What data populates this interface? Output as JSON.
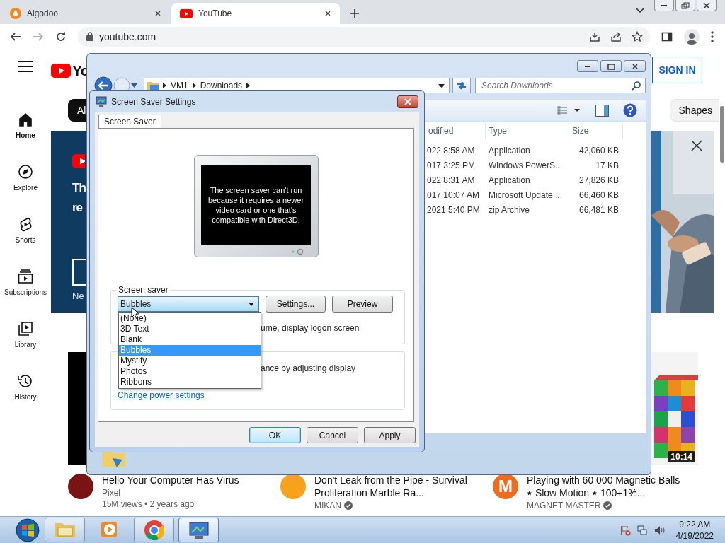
{
  "browser": {
    "tabs": [
      {
        "title": "Algodoo",
        "selected": false
      },
      {
        "title": "YouTube",
        "selected": true
      }
    ],
    "url": "youtube.com"
  },
  "youtube": {
    "logo_text": "Yo",
    "sign_in": "SIGN IN",
    "sidebar": [
      {
        "kind": "home",
        "label": "Home",
        "selected": true
      },
      {
        "kind": "explore",
        "label": "Explore",
        "selected": false
      },
      {
        "kind": "shorts",
        "label": "Shorts",
        "selected": false
      },
      {
        "kind": "subscriptions",
        "label": "Subscriptions",
        "selected": false
      },
      {
        "kind": "library",
        "label": "Library",
        "selected": false
      },
      {
        "kind": "history",
        "label": "History",
        "selected": false
      }
    ],
    "chips": [
      {
        "label": "Al",
        "selected": true
      },
      {
        "label": "Shapes",
        "selected": false
      }
    ],
    "banner": {
      "lines": [
        "Th",
        "re"
      ],
      "button_label": "Ne"
    },
    "videos": [
      {
        "title": "Hello Your Computer Has Virus",
        "channel": "Pixel",
        "verified": false,
        "meta": "15M views • 2 years ago",
        "color": "#7a1414"
      },
      {
        "title": "Don't Leak from the Pipe - Survival Proliferation Marble Ra...",
        "channel": "MIKAN",
        "verified": true,
        "color": "#f7a21b"
      },
      {
        "title": "Playing with 60 000 Magnetic Balls ⭑ Slow Motion ⭑ 100+1%...",
        "channel": "MAGNET MASTER",
        "verified": true,
        "color": "#f26b1d",
        "avatar_letter": "M",
        "duration": "10:14"
      }
    ]
  },
  "explorer": {
    "path": [
      "VM1",
      "Downloads"
    ],
    "search_placeholder": "Search Downloads",
    "columns": [
      "odified",
      "Type",
      "Size"
    ],
    "rows": [
      {
        "cells": [
          "022 8:58 AM",
          "Application",
          "42,060 KB"
        ]
      },
      {
        "cells": [
          "017 3:25 PM",
          "Windows PowerS...",
          "17 KB"
        ]
      },
      {
        "cells": [
          "022 8:31 AM",
          "Application",
          "27,826 KB"
        ]
      },
      {
        "cells": [
          "017 10:07 AM",
          "Microsoft Update ...",
          "66,460 KB"
        ]
      },
      {
        "cells": [
          "2021 5:40 PM",
          "zip Archive",
          "66,481 KB"
        ]
      }
    ]
  },
  "dialog": {
    "title": "Screen Saver Settings",
    "tabs": [
      {
        "label": "Screen Saver",
        "selected": true
      }
    ],
    "preview_message": "The screen saver can't run because it requires a newer video card or one that's compatible with Direct3D.",
    "group_label": "Screen saver",
    "dropdown": {
      "value": "Bubbles",
      "expanded": true,
      "options": [
        {
          "label": "(None)",
          "selected": false
        },
        {
          "label": "3D Text",
          "selected": false
        },
        {
          "label": "Blank",
          "selected": false
        },
        {
          "label": "Bubbles",
          "selected": true
        },
        {
          "label": "Mystify",
          "selected": false
        },
        {
          "label": "Photos",
          "selected": false
        },
        {
          "label": "Ribbons",
          "selected": false
        }
      ]
    },
    "group_buttons": [
      "Settings...",
      "Preview"
    ],
    "logon_text": "ume, display logon screen",
    "power_text": "ance by adjusting display",
    "power_link": "Change power settings",
    "buttons": [
      {
        "label": "OK",
        "default": true
      },
      {
        "label": "Cancel",
        "default": false
      },
      {
        "label": "Apply",
        "default": false
      }
    ]
  },
  "taskbar": {
    "apps": [
      {
        "kind": "explorer",
        "running": true,
        "active": false
      },
      {
        "kind": "media",
        "running": false,
        "active": false
      },
      {
        "kind": "chrome",
        "running": true,
        "active": false
      },
      {
        "kind": "screensaver",
        "running": true,
        "active": true
      }
    ],
    "time": "9:22 AM",
    "date": "4/19/2022"
  }
}
